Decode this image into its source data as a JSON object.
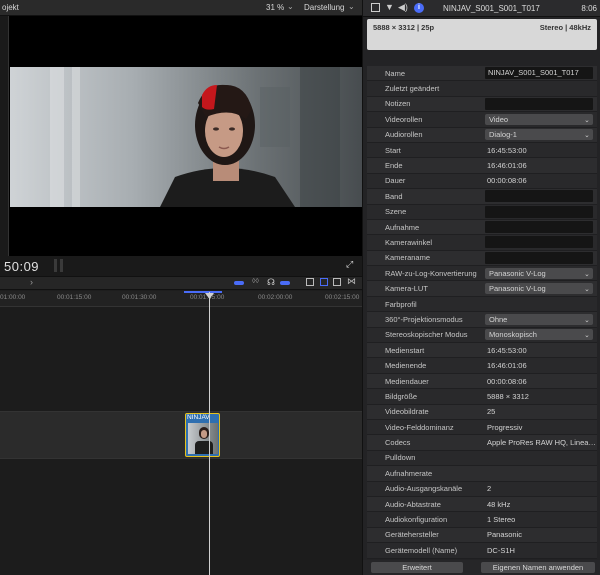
{
  "left_header": {
    "project_label": "ojekt",
    "zoom": "31 %",
    "view_label": "Darstellung"
  },
  "timeline": {
    "timecode": "50:09",
    "ruler_ticks": [
      "01:00:00",
      "00:01:15:00",
      "00:01:30:00",
      "00:01:45:00",
      "00:02:00:00",
      "00:02:15:00"
    ],
    "clip_name": "NINJAV"
  },
  "inspector": {
    "clip_title": "NINJAV_S001_S001_T017",
    "duration_top": "8:06",
    "resolution_info": "5888 × 3312 | 25p",
    "audio_info": "Stereo | 48kHz",
    "rows": [
      {
        "label": "Name",
        "value": "NINJAV_S001_S001_T017",
        "kind": "field"
      },
      {
        "label": "Zuletzt geändert",
        "value": "",
        "kind": "text"
      },
      {
        "label": "Notizen",
        "value": "",
        "kind": "field"
      },
      {
        "label": "Videorollen",
        "value": "Video",
        "kind": "select"
      },
      {
        "label": "Audiorollen",
        "value": "Dialog-1",
        "kind": "select"
      },
      {
        "label": "Start",
        "value": "16:45:53:00",
        "kind": "text"
      },
      {
        "label": "Ende",
        "value": "16:46:01:06",
        "kind": "text"
      },
      {
        "label": "Dauer",
        "value": "00:00:08:06",
        "kind": "text"
      },
      {
        "label": "Band",
        "value": "",
        "kind": "field"
      },
      {
        "label": "Szene",
        "value": "",
        "kind": "field"
      },
      {
        "label": "Aufnahme",
        "value": "",
        "kind": "field"
      },
      {
        "label": "Kamerawinkel",
        "value": "",
        "kind": "field"
      },
      {
        "label": "Kameraname",
        "value": "",
        "kind": "field"
      },
      {
        "label": "RAW-zu-Log-Konvertierung",
        "value": "Panasonic V-Log",
        "kind": "select"
      },
      {
        "label": "Kamera-LUT",
        "value": "Panasonic V-Log",
        "kind": "select"
      },
      {
        "label": "Farbprofil",
        "value": "",
        "kind": "text"
      },
      {
        "label": "360°-Projektionsmodus",
        "value": "Ohne",
        "kind": "select"
      },
      {
        "label": "Stereoskopischer Modus",
        "value": "Monoskopisch",
        "kind": "select"
      },
      {
        "label": "Medienstart",
        "value": "16:45:53:00",
        "kind": "text"
      },
      {
        "label": "Medienende",
        "value": "16:46:01:06",
        "kind": "text"
      },
      {
        "label": "Mediendauer",
        "value": "00:00:08:06",
        "kind": "text"
      },
      {
        "label": "Bildgröße",
        "value": "5888 × 3312",
        "kind": "text"
      },
      {
        "label": "Videobildrate",
        "value": "25",
        "kind": "text"
      },
      {
        "label": "Video-Felddominanz",
        "value": "Progressiv",
        "kind": "text"
      },
      {
        "label": "Codecs",
        "value": "Apple ProRes RAW HQ, Linea…",
        "kind": "text"
      },
      {
        "label": "Pulldown",
        "value": "",
        "kind": "text"
      },
      {
        "label": "Aufnahmerate",
        "value": "",
        "kind": "text"
      },
      {
        "label": "Audio-Ausgangskanäle",
        "value": "2",
        "kind": "text"
      },
      {
        "label": "Audio-Abtastrate",
        "value": "48 kHz",
        "kind": "text"
      },
      {
        "label": "Audiokonfiguration",
        "value": "1 Stereo",
        "kind": "text"
      },
      {
        "label": "Gerätehersteller",
        "value": "Panasonic",
        "kind": "text"
      },
      {
        "label": "Gerätemodell (Name)",
        "value": "DC-S1H",
        "kind": "text"
      }
    ],
    "bottom": {
      "advanced_label": "Erweitert",
      "apply_names_label": "Eigenen Namen anwenden"
    }
  },
  "colors": {
    "clip_border": "#e6c21d",
    "clip_fill": "#2f6fb0",
    "accent": "#4a6cf7"
  }
}
